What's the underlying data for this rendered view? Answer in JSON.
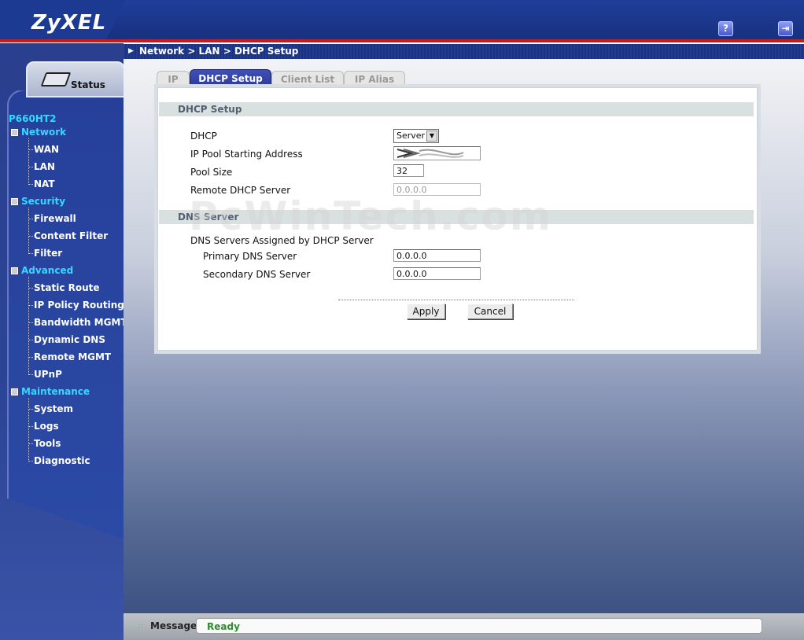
{
  "header": {
    "logo": "ZyXEL",
    "help_icon_glyph": "?",
    "logout_icon_glyph": "⇥"
  },
  "breadcrumb": "Network > LAN > DHCP Setup",
  "sidebar": {
    "status_label": "Status",
    "model": "P660HT2",
    "sections": [
      {
        "label": "Network",
        "items": [
          "WAN",
          "LAN",
          "NAT"
        ]
      },
      {
        "label": "Security",
        "items": [
          "Firewall",
          "Content Filter",
          "Filter"
        ]
      },
      {
        "label": "Advanced",
        "items": [
          "Static Route",
          "IP Policy Routing",
          "Bandwidth MGMT",
          "Dynamic DNS",
          "Remote MGMT",
          "UPnP"
        ]
      },
      {
        "label": "Maintenance",
        "items": [
          "System",
          "Logs",
          "Tools",
          "Diagnostic"
        ]
      }
    ]
  },
  "tabs": [
    {
      "label": "IP",
      "active": false
    },
    {
      "label": "DHCP Setup",
      "active": true
    },
    {
      "label": "Client List",
      "active": false
    },
    {
      "label": "IP Alias",
      "active": false
    }
  ],
  "dhcp_setup": {
    "heading": "DHCP Setup",
    "dhcp_label": "DHCP",
    "dhcp_value": "Server",
    "ip_pool_label": "IP Pool Starting Address",
    "ip_pool_value": "",
    "pool_size_label": "Pool Size",
    "pool_size_value": "32",
    "remote_dhcp_label": "Remote DHCP Server",
    "remote_dhcp_value": "0.0.0.0"
  },
  "dns_server": {
    "heading": "DNS Server",
    "assigned_label": "DNS Servers Assigned by DHCP Server",
    "primary_label": "Primary DNS Server",
    "primary_value": "0.0.0.0",
    "secondary_label": "Secondary DNS Server",
    "secondary_value": "0.0.0.0"
  },
  "buttons": {
    "apply": "Apply",
    "cancel": "Cancel"
  },
  "watermark": "PcWinTech.com",
  "message_bar": {
    "label": "Message",
    "status": "Ready"
  }
}
